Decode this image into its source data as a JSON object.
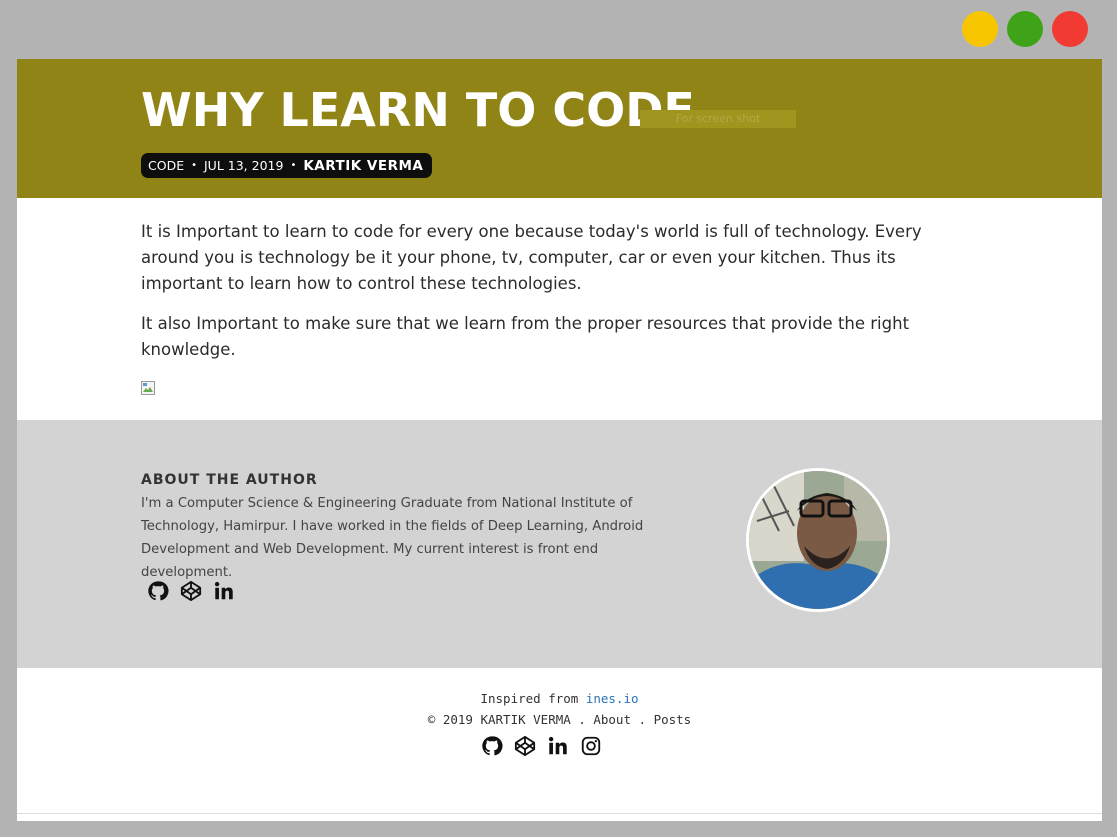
{
  "window": {
    "controls": [
      "minimize",
      "maximize",
      "close"
    ],
    "colors": {
      "minimize": "#f7c600",
      "maximize": "#3fa31a",
      "close": "#f13a32"
    }
  },
  "header": {
    "title": "WHY LEARN TO CODE",
    "fullscreen_hint": "For screen shot",
    "category": "CODE",
    "date": "JUL 13, 2019",
    "author": "KARTIK VERMA",
    "background": "#918417"
  },
  "post": {
    "paragraphs": [
      "It is Important to learn to code for every one because today's world is full of technology. Every around you is technology be it your phone, tv, computer, car or even your kitchen. Thus its important to learn how to control these technologies.",
      "It also Important to make sure that we learn from the proper resources that provide the right knowledge."
    ]
  },
  "about": {
    "heading": "ABOUT THE AUTHOR",
    "bio": "I'm a Computer Science & Engineering Graduate from National Institute of Technology, Hamirpur. I have worked in the fields of Deep Learning, Android Development and Web Development. My current interest is front end development.",
    "social_icons": [
      "github-icon",
      "codepen-icon",
      "linkedin-icon"
    ]
  },
  "footer": {
    "inspired_prefix": "Inspired from ",
    "inspired_link": "ines.io",
    "copyright": "© 2019 KARTIK VERMA",
    "sep1": " . ",
    "about_link": "About",
    "sep2": " . ",
    "posts_link": "Posts",
    "social_icons": [
      "github-icon",
      "codepen-icon",
      "linkedin-icon",
      "instagram-icon"
    ]
  }
}
